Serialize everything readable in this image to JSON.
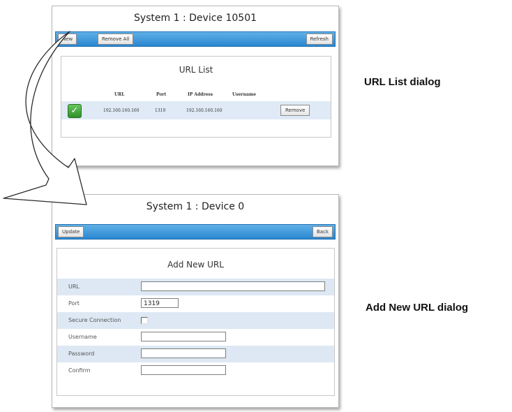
{
  "url_list_window": {
    "title": "System 1 : Device 10501",
    "toolbar": {
      "new_label": "New",
      "remove_all_label": "Remove All",
      "refresh_label": "Refresh"
    },
    "list_title": "URL List",
    "columns": [
      "URL",
      "Port",
      "IP Address",
      "Username"
    ],
    "rows": [
      {
        "enabled": true,
        "url": "192.160.160.160",
        "port": "1319",
        "ip": "192.160.160.160",
        "username": "",
        "action_label": "Remove"
      }
    ]
  },
  "add_url_window": {
    "title": "System 1 : Device 0",
    "toolbar": {
      "update_label": "Update",
      "back_label": "Back"
    },
    "form_title": "Add New URL",
    "fields": {
      "url": {
        "label": "URL",
        "value": ""
      },
      "port": {
        "label": "Port",
        "value": "1319"
      },
      "secure": {
        "label": "Secure Connection",
        "checked": false
      },
      "username": {
        "label": "Username",
        "value": ""
      },
      "password": {
        "label": "Password",
        "value": ""
      },
      "confirm": {
        "label": "Confirm",
        "value": ""
      }
    }
  },
  "captions": {
    "url_list": "URL List dialog",
    "add_url": "Add New URL dialog"
  },
  "colors": {
    "toolbar": "#2a86d0",
    "row_shade": "#dde8f4",
    "check_green": "#3aa335"
  },
  "icons": {
    "enabled": "checkmark-icon",
    "flow": "curved-arrow"
  }
}
